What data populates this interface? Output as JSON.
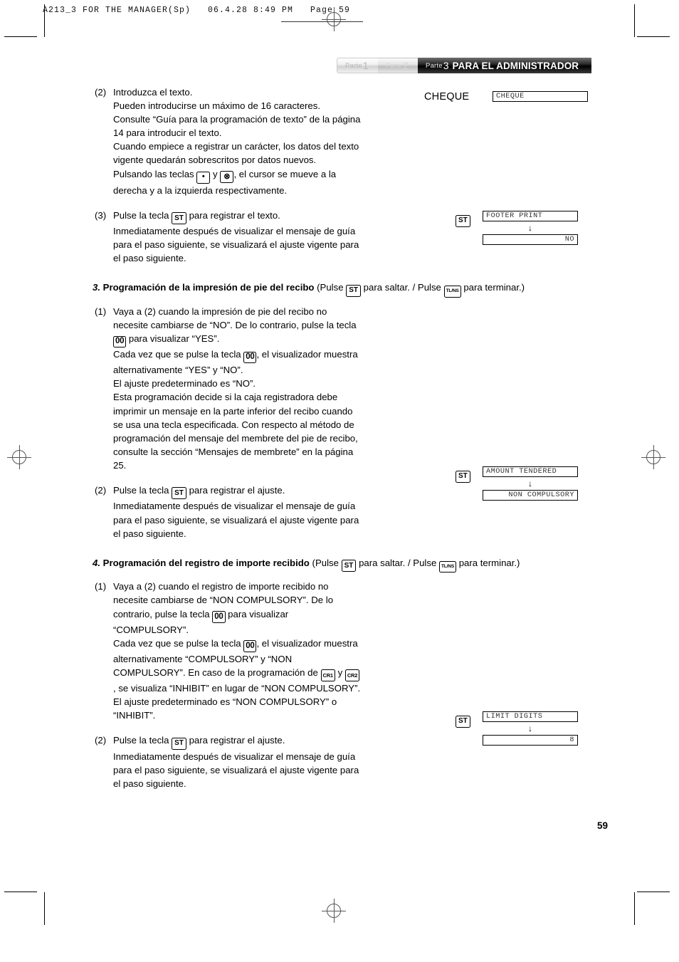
{
  "film_header": "A213_3 FOR THE MANAGER(Sp)   06.4.28 8:49 PM   Page 59",
  "banner": {
    "part1_prefix": "Parte",
    "part1_num": "1",
    "part2_prefix": "Parte",
    "part2_num": "2",
    "part3_prefix": "Parte",
    "part3_num": "3",
    "part3_title": "PARA EL ADMINISTRADOR"
  },
  "keys": {
    "st": "ST",
    "tlns": "TL/NS",
    "zero_zero": "00",
    "cr1": "CR1",
    "cr2": "CR2",
    "dot": "•",
    "multiply": "⊗"
  },
  "steps": {
    "step2_text": {
      "marker": "(2)",
      "line1": "Introduzca el texto.",
      "line2": "Pueden introducirse un máximo de 16 caracteres.",
      "line3": "Consulte “Guía para la programación de texto” de la página 14 para introducir el texto.",
      "line4": "Cuando empiece a registrar un carácter, los datos del texto vigente quedarán sobrescritos por datos nuevos.",
      "line5_a": "Pulsando las teclas",
      "line5_b": "y",
      "line5_c": ", el cursor se mueve a la derecha y a la izquierda respectivamente."
    },
    "step3_text": {
      "marker": "(3)",
      "a": "Pulse la tecla",
      "b": "para registrar el texto.",
      "c": "Inmediatamente después de visualizar el mensaje de guía para el paso siguiente, se visualizará el ajuste vigente para el paso siguiente."
    }
  },
  "section3": {
    "number": "3.",
    "title": "Programación de la impresión de pie del recibo",
    "paren_open": "(Pulse",
    "skip": "para saltar. / Pulse",
    "finish": "para terminar.)",
    "item1": {
      "marker": "(1)",
      "p1_a": "Vaya a (2) cuando la impresión de pie del recibo no necesite cambiarse de “NO”. De lo contrario, pulse la tecla",
      "p1_b": "para visualizar “YES”.",
      "p2_a": "Cada vez que se pulse la tecla",
      "p2_b": ", el visualizador muestra alternativamente “YES” y “NO”.",
      "p3": "El ajuste predeterminado es “NO”.",
      "p4": "Esta programación decide si la caja registradora debe imprimir un mensaje en la parte inferior del recibo cuando se usa una tecla especificada. Con respecto al método de programación del mensaje del membrete del pie de recibo, consulte la sección “Mensajes de membrete” en la página 25."
    },
    "item2": {
      "marker": "(2)",
      "a": "Pulse la tecla",
      "b": "para registrar el ajuste.",
      "c": "Inmediatamente después de visualizar el mensaje de guía para el paso siguiente, se visualizará el ajuste vigente para el paso siguiente."
    }
  },
  "section4": {
    "number": "4.",
    "title": "Programación del registro de importe recibido",
    "paren_open": "(Pulse",
    "skip": "para saltar. / Pulse",
    "finish": "para terminar.)",
    "item1": {
      "marker": "(1)",
      "p1_a": "Vaya a (2) cuando el registro de importe recibido no necesite cambiarse de “NON COMPULSORY”. De lo contrario, pulse la tecla",
      "p1_b": "para visualizar “COMPULSORY”.",
      "p2_a": "Cada vez que se pulse la tecla",
      "p2_b": ", el visualizador muestra alternativamente “COMPULSORY” y “NON COMPULSORY”. En caso de la programación de",
      "p2_c": "y",
      "p2_d": ", se visualiza “INHIBIT” en lugar de “NON COMPULSORY”.",
      "p3": "El ajuste predeterminado es “NON COMPULSORY” o “INHIBIT”."
    },
    "item2": {
      "marker": "(2)",
      "a": "Pulse la tecla",
      "b": "para registrar el ajuste.",
      "c": "Inmediatamente después de visualizar el mensaje de guía para el paso siguiente, se visualizará el ajuste vigente para el paso siguiente."
    }
  },
  "diagrams": {
    "cheque": {
      "label": "CHEQUE",
      "display": "CHEQUE"
    },
    "footer_print": {
      "key": "ST",
      "display_top": "FOOTER PRINT",
      "arrow": "↓",
      "display_bottom": "NO"
    },
    "amount_tendered": {
      "key": "ST",
      "display_top": "AMOUNT TENDERED",
      "arrow": "↓",
      "display_bottom": "NON COMPULSORY"
    },
    "limit_digits": {
      "key": "ST",
      "display_top": "LIMIT DIGITS",
      "arrow": "↓",
      "display_bottom": "8"
    }
  },
  "page_number": "59"
}
